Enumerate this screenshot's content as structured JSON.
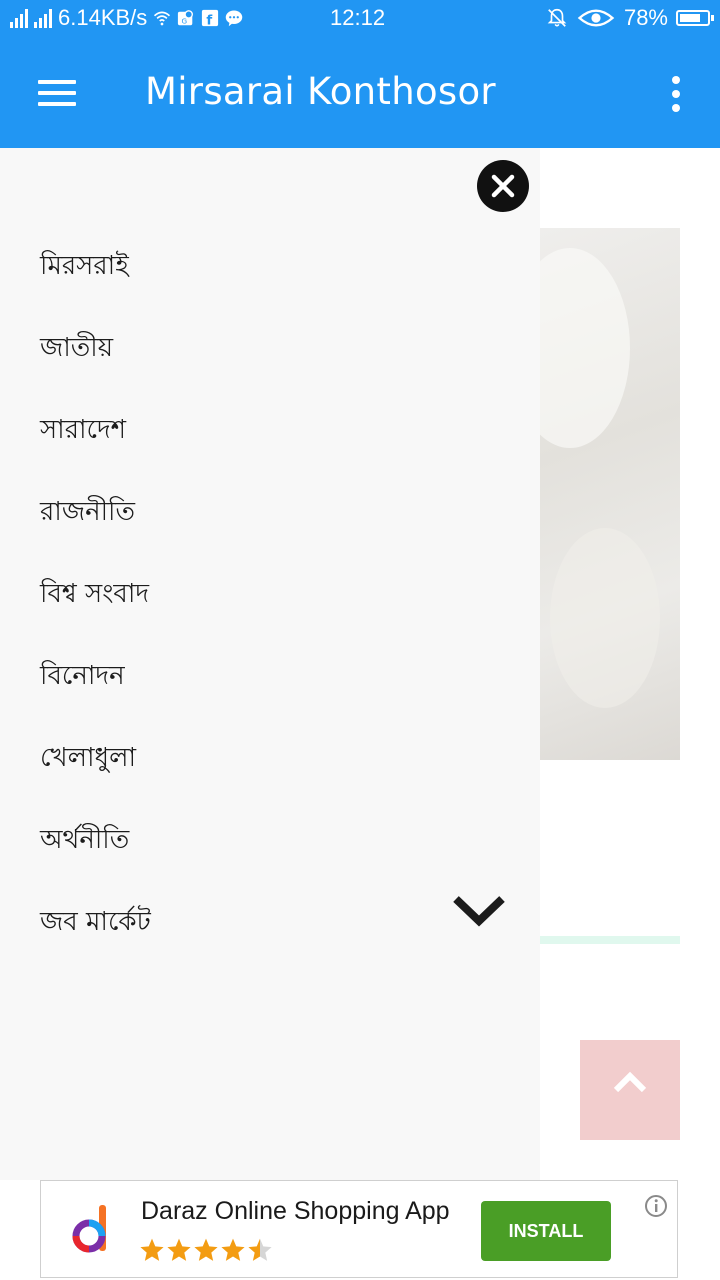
{
  "status_bar": {
    "network_speed": "6.14KB/s",
    "time": "12:12",
    "battery": "78%",
    "battery_level": 0.78,
    "icons": [
      "signal-icon",
      "signal-icon",
      "wifi-icon",
      "location-app-icon",
      "facebook-icon",
      "messenger-icon",
      "mute-icon",
      "eye-icon",
      "battery-icon"
    ]
  },
  "app_bar": {
    "title": "Mirsarai Konthosor",
    "color": "#2196f3",
    "menu_icon": "hamburger-icon",
    "overflow_icon": "more-vert-icon"
  },
  "drawer": {
    "close_icon": "close-icon",
    "expand_icon": "chevron-down-icon",
    "items": [
      {
        "label": "মিরসরাই"
      },
      {
        "label": "জাতীয়"
      },
      {
        "label": "সারাদেশ"
      },
      {
        "label": "রাজনীতি"
      },
      {
        "label": "বিশ্ব সংবাদ"
      },
      {
        "label": "বিনোদন"
      },
      {
        "label": "খেলাধুলা"
      },
      {
        "label": "অর্থনীতি"
      },
      {
        "label": "জব মার্কেট"
      }
    ]
  },
  "scroll_top": {
    "icon": "chevron-up-icon",
    "color": "#f2cdcd"
  },
  "ad": {
    "title": "Daraz Online Shopping App",
    "rating": 4.5,
    "install_label": "INSTALL",
    "install_color": "#4a9e26",
    "info_icon": "info-icon",
    "logo_icon": "daraz-logo-icon"
  }
}
